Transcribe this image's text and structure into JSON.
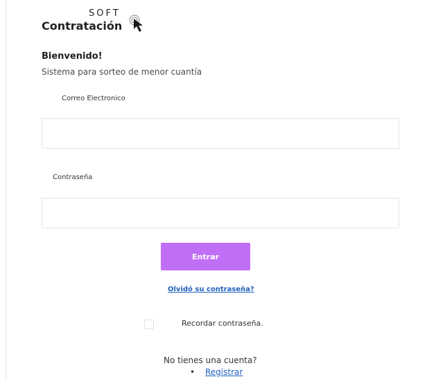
{
  "logo": {
    "top_text": "SOFT",
    "main_text": "Contratación",
    "icon": "cursor-arrow-icon"
  },
  "heading": {
    "title": "Bienvenido!",
    "subtitle": "Sistema para sorteo de menor cuantía"
  },
  "form": {
    "email_label": "Correo Electronico",
    "email_value": "",
    "email_placeholder": "",
    "password_label": "Contraseña",
    "password_value": "",
    "password_placeholder": "",
    "submit_label": "Entrar",
    "forgot_label": "Olvidó su contraseña?",
    "remember_label": "Recordar contraseña.",
    "remember_checked": false
  },
  "signup": {
    "prompt": "No tienes una cuenta?",
    "bullet": "•",
    "link_label": "Registrar"
  },
  "colors": {
    "button": "#c06ef5",
    "link": "#1f5fbf",
    "border": "#e4e4e4"
  }
}
